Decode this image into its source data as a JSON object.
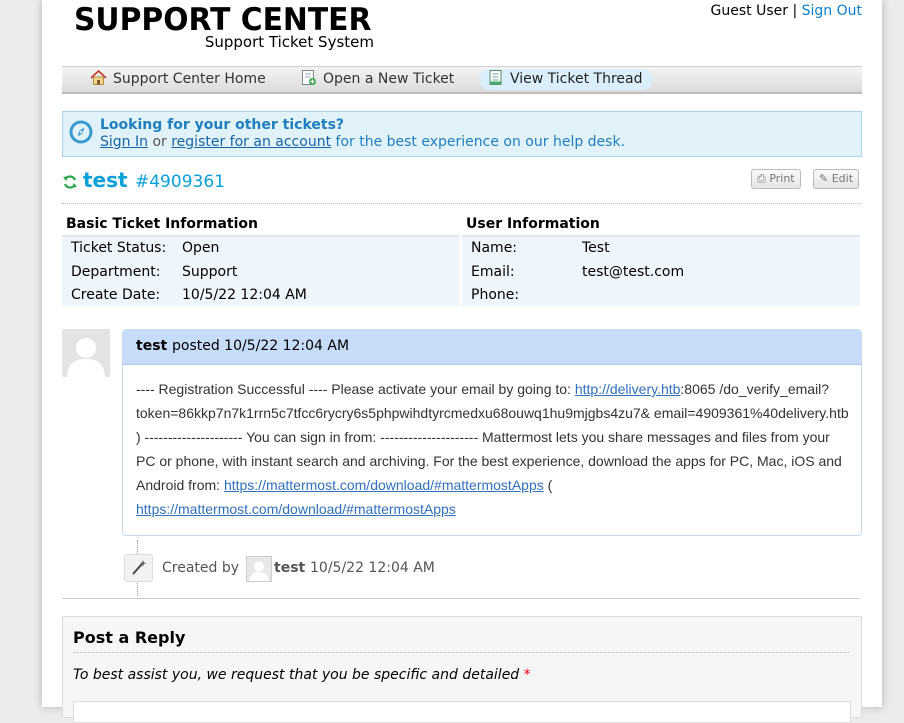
{
  "header": {
    "logo_title": "SUPPORT CENTER",
    "logo_subtitle": "Support Ticket System",
    "user_label": "Guest User",
    "separator": "|",
    "signout_label": "Sign Out"
  },
  "nav": {
    "items": [
      {
        "label": "Support Center Home",
        "icon": "home-icon"
      },
      {
        "label": "Open a New Ticket",
        "icon": "new-ticket-icon"
      },
      {
        "label": "View Ticket Thread",
        "icon": "ticket-thread-icon",
        "active": true
      }
    ]
  },
  "notice": {
    "heading": "Looking for your other tickets?",
    "signin_label": "Sign In",
    "or_text": "or",
    "register_label": "register for an account",
    "tail_text": "for the best experience on our help desk."
  },
  "ticket": {
    "subject": "test",
    "number": "#4909361",
    "print_label": "Print",
    "edit_label": "Edit"
  },
  "basic_info": {
    "heading": "Basic Ticket Information",
    "rows": [
      {
        "label": "Ticket Status:",
        "value": "Open"
      },
      {
        "label": "Department:",
        "value": "Support"
      },
      {
        "label": "Create Date:",
        "value": "10/5/22 12:04 AM"
      }
    ]
  },
  "user_info": {
    "heading": "User Information",
    "rows": [
      {
        "label": "Name:",
        "value": "Test"
      },
      {
        "label": "Email:",
        "value": "test@test.com"
      },
      {
        "label": "Phone:",
        "value": ""
      }
    ]
  },
  "thread": {
    "author": "test",
    "posted_text": "posted 10/5/22 12:04 AM",
    "msg_part1": "---- Registration Successful ---- Please activate your email by going to: ",
    "msg_link1": "http://delivery.htb",
    "msg_part2": ":8065 /do_verify_email?token=86kkp7n7k1rrn5c7tfcc6rycry6s5phpwihdtyrcmedxu68ouwq1hu9mjgbs4zu7& email=4909361%40delivery.htb ) --------------------- You can sign in from: --------------------- Mattermost lets you share messages and files from your PC or phone, with instant search and archiving. For the best experience, download the apps for PC, Mac, iOS and Android from: ",
    "msg_link2": "https://mattermost.com/download/#mattermostApps",
    "msg_part3": " ( ",
    "msg_link3": "https://mattermost.com/download/#mattermostApps"
  },
  "event": {
    "created_by": "Created by",
    "author": "test",
    "time": "10/5/22 12:04 AM"
  },
  "reply": {
    "title": "Post a Reply",
    "instruction": "To best assist you, we request that you be specific and detailed",
    "required_mark": "*"
  }
}
